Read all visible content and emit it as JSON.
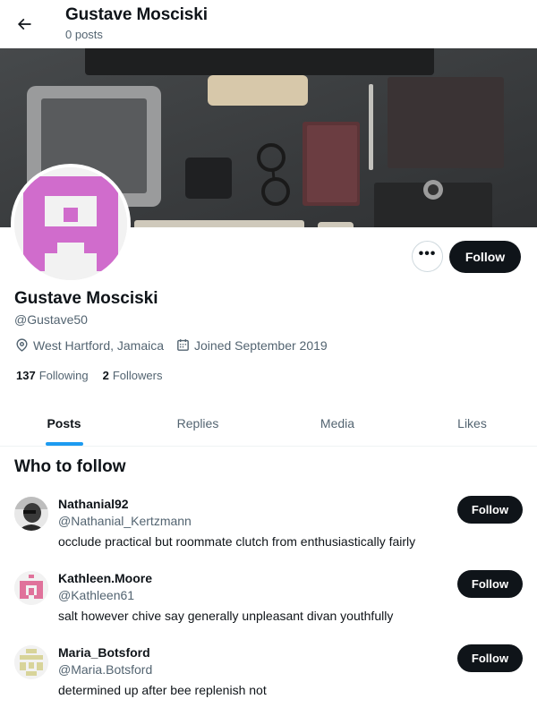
{
  "header": {
    "title": "Gustave Mosciski",
    "subtitle": "0 posts"
  },
  "profile": {
    "name": "Gustave Mosciski",
    "handle": "@Gustave50",
    "location": "West Hartford, Jamaica",
    "joined": "Joined September 2019",
    "following_count": "137",
    "following_label": "Following",
    "followers_count": "2",
    "followers_label": "Followers",
    "follow_label": "Follow",
    "more_label": "•••",
    "avatar_color": "#d06ccc"
  },
  "tabs": [
    {
      "label": "Posts",
      "active": true
    },
    {
      "label": "Replies",
      "active": false
    },
    {
      "label": "Media",
      "active": false
    },
    {
      "label": "Likes",
      "active": false
    }
  ],
  "who_to_follow": {
    "title": "Who to follow",
    "users": [
      {
        "name": "Nathanial92",
        "handle": "@Nathanial_Kertzmann",
        "bio": "occlude practical but roommate clutch from enthusiastically fairly",
        "follow_label": "Follow",
        "avatar_type": "photo"
      },
      {
        "name": "Kathleen.Moore",
        "handle": "@Kathleen61",
        "bio": "salt however chive say generally unpleasant divan youthfully",
        "follow_label": "Follow",
        "avatar_color": "#e0729b"
      },
      {
        "name": "Maria_Botsford",
        "handle": "@Maria.Botsford",
        "bio": "determined up after bee replenish not",
        "follow_label": "Follow",
        "avatar_color": "#d8d49a"
      }
    ]
  },
  "colors": {
    "accent": "#1d9bf0",
    "text": "#0f1419",
    "secondary": "#536471",
    "button": "#0f1419"
  }
}
